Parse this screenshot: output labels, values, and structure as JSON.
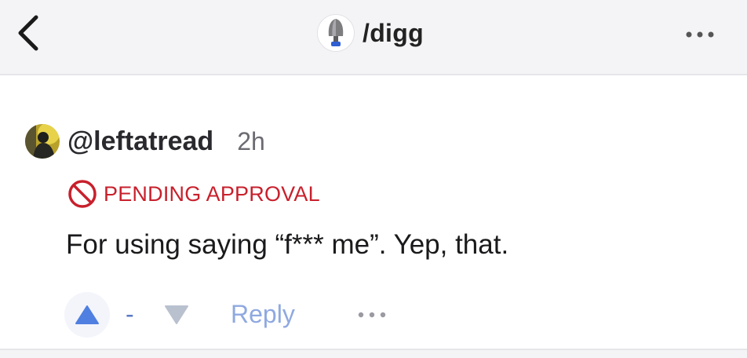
{
  "header": {
    "community_name": "/digg",
    "back_icon": "chevron-left-icon",
    "more_icon": "more-horizontal-icon"
  },
  "comment": {
    "username": "@leftatread",
    "time": "2h",
    "status": "PENDING APPROVAL",
    "status_icon": "prohibited-icon",
    "body": "For using saying “f*** me”. Yep, that.",
    "score": "-",
    "reply_label": "Reply"
  },
  "colors": {
    "header_bg": "#f4f4f6",
    "pending_red": "#c8202c",
    "upvote_blue": "#4f7fe0",
    "reply_blue": "#8fa9e0"
  }
}
